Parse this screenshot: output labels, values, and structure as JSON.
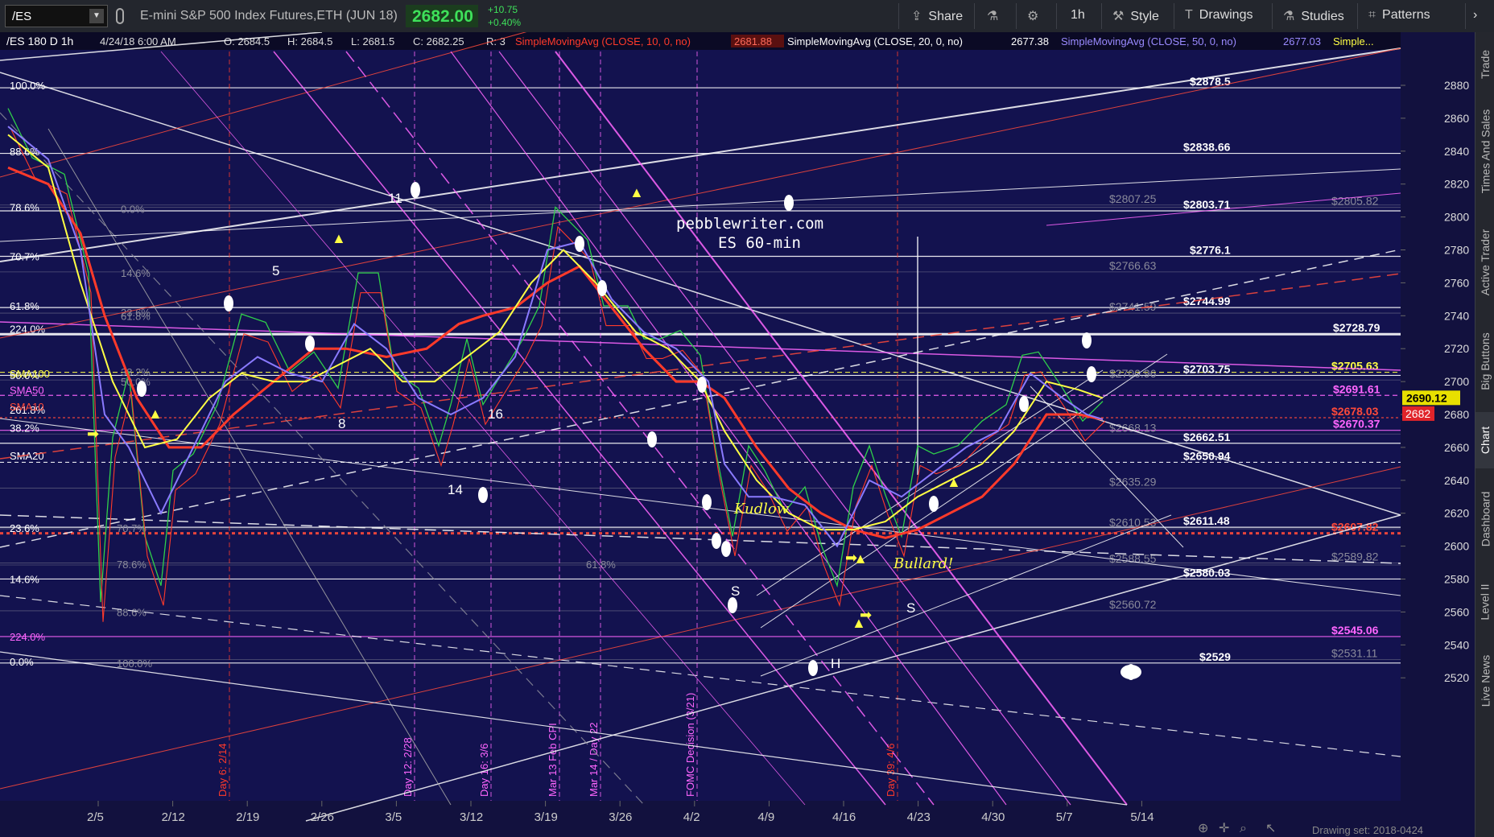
{
  "toolbar": {
    "symbol": "/ES",
    "description": "E-mini S&P 500 Index Futures,ETH (JUN 18)",
    "last_price": "2682.00",
    "change": "+10.75",
    "change_pct": "+0.40%",
    "share": "Share",
    "timeframe": "1h",
    "style": "Style",
    "drawings": "Drawings",
    "studies": "Studies",
    "patterns": "Patterns"
  },
  "info_bar": {
    "header": "/ES 180 D 1h",
    "date": "4/24/18 6:00 AM",
    "open": "O: 2684.5",
    "high": "H: 2684.5",
    "low": "L: 2681.5",
    "close": "C: 2682.25",
    "range": "R: 3",
    "sma10_label": "SimpleMovingAvg (CLOSE, 10, 0, no)",
    "sma10_value": "2681.88",
    "sma20_label": "SimpleMovingAvg (CLOSE, 20, 0, no)",
    "sma20_value": "2677.38",
    "sma50_label": "SimpleMovingAvg (CLOSE, 50, 0, no)",
    "sma50_value": "2677.03",
    "more": "Simple..."
  },
  "watermark": [
    "pebblewriter.com",
    "ES 60-min"
  ],
  "y_axis": {
    "ticks": [
      "2880",
      "2860",
      "2840",
      "2820",
      "2800",
      "2780",
      "2760",
      "2740",
      "2720",
      "2700",
      "2680",
      "2660",
      "2640",
      "2620",
      "2600",
      "2580",
      "2560",
      "2540",
      "2520"
    ],
    "current_price": "2690.12",
    "last": "2682"
  },
  "x_axis": [
    "2/5",
    "2/12",
    "2/19",
    "2/26",
    "3/5",
    "3/12",
    "3/19",
    "3/26",
    "4/2",
    "4/9",
    "4/16",
    "4/23",
    "4/30",
    "5/7",
    "5/14"
  ],
  "level_labels": [
    {
      "text": "$2878.5",
      "color": "#ffffff"
    },
    {
      "text": "$2838.66",
      "color": "#ffffff"
    },
    {
      "text": "$2807.25",
      "color": "#8a8a9a"
    },
    {
      "text": "$2805.82",
      "color": "#8a8a9a"
    },
    {
      "text": "$2803.71",
      "color": "#ffffff"
    },
    {
      "text": "$2776.1",
      "color": "#ffffff"
    },
    {
      "text": "$2766.63",
      "color": "#8a8a9a"
    },
    {
      "text": "$2744.99",
      "color": "#ffffff"
    },
    {
      "text": "$2741.59",
      "color": "#8a8a9a"
    },
    {
      "text": "$2728.79",
      "color": "#ffffff"
    },
    {
      "text": "$2705.63",
      "color": "#ffff44"
    },
    {
      "text": "$2703.75",
      "color": "#ffffff"
    },
    {
      "text": "$2700.96",
      "color": "#8a8a9a"
    },
    {
      "text": "$2691.61",
      "color": "#ff66ff"
    },
    {
      "text": "$2678.03",
      "color": "#ff4a3a"
    },
    {
      "text": "$2670.37",
      "color": "#ff66ff"
    },
    {
      "text": "$2668.13",
      "color": "#8a8a9a"
    },
    {
      "text": "$2662.51",
      "color": "#ffffff"
    },
    {
      "text": "$2650.94",
      "color": "#ffffff"
    },
    {
      "text": "$2635.29",
      "color": "#8a8a9a"
    },
    {
      "text": "$2611.48",
      "color": "#ffffff"
    },
    {
      "text": "$2610.53",
      "color": "#8a8a9a"
    },
    {
      "text": "$2607.82",
      "color": "#ff4a3a"
    },
    {
      "text": "$2589.82",
      "color": "#8a8a9a"
    },
    {
      "text": "$2588.55",
      "color": "#8a8a9a"
    },
    {
      "text": "$2580.03",
      "color": "#ffffff"
    },
    {
      "text": "$2560.72",
      "color": "#8a8a9a"
    },
    {
      "text": "$2545.06",
      "color": "#ff66ff"
    },
    {
      "text": "$2531.11",
      "color": "#8a8a9a"
    },
    {
      "text": "$2529",
      "color": "#ffffff"
    }
  ],
  "fib_labels": [
    "100.0%",
    "88.6%",
    "78.6%",
    "70.7%",
    "61.8%",
    "224.0%",
    "50.0%",
    "261.8%",
    "38.2%",
    "23.6%",
    "14.6%",
    "224.0%",
    "0.0%"
  ],
  "sma_labels": [
    "SMA100",
    "SMA50",
    "SMA10",
    "SMA20"
  ],
  "inner_fib_labels": [
    "0.0%",
    "14.6%",
    "23.6%",
    "38.2%",
    "50.0%",
    "61.8%",
    "70.7%",
    "78.6%",
    "88.6%",
    "100.0%",
    "61.8%"
  ],
  "wave_labels": [
    "11",
    "5",
    "8",
    "14",
    "16"
  ],
  "pattern_labels": [
    "S",
    "H",
    "S"
  ],
  "annotations": [
    "Kudlow",
    "Bullard!"
  ],
  "event_labels": [
    "Day 6: 2/14",
    "Day 12: 2/28",
    "Day 16: 3/6",
    "Mar 13 Feb CPI",
    "Mar 14 / Day 22",
    "FOMC Decision (3/21)",
    "Day 39: 4/6"
  ],
  "drawing_set": "Drawing set: 2018-0424",
  "right_tabs": [
    "Trade",
    "Times And Sales",
    "Active Trader",
    "Big Buttons",
    "Chart",
    "Dashboard",
    "Level II",
    "Live News"
  ]
}
